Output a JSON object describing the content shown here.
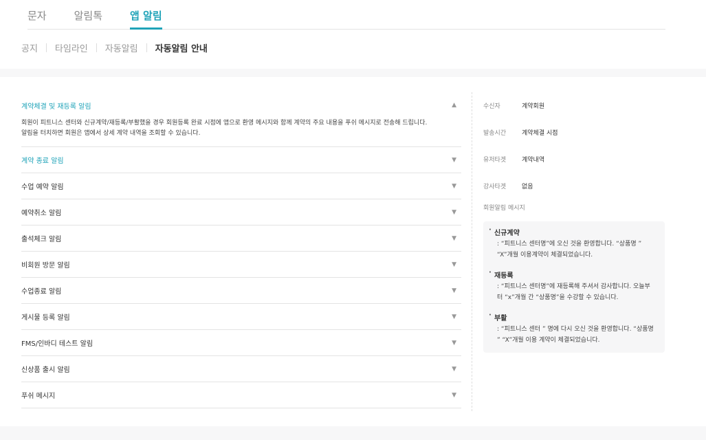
{
  "tabs": [
    {
      "label": "문자",
      "active": false
    },
    {
      "label": "알림톡",
      "active": false
    },
    {
      "label": "앱 알림",
      "active": true
    }
  ],
  "subtabs": [
    {
      "label": "공지",
      "active": false
    },
    {
      "label": "타임라인",
      "active": false
    },
    {
      "label": "자동알림",
      "active": false
    },
    {
      "label": "자동알림 안내",
      "active": true
    }
  ],
  "accordion": {
    "expanded": {
      "label": "계약체결 및 재등록 알림",
      "description_line1": "회원이 피트니스 센터와 신규계약/재등록/부활했을 경우 회원등록 완료 시점에 앱으로 환영 메시지와 함께 계약의 주요 내용을 푸쉬 메시지로 전송해 드립니다.",
      "description_line2": "알림을 터치하면 회원은 앱에서 상세 계약 내역을 조회할 수 있습니다."
    },
    "items": [
      {
        "label": "계약 종료 알림"
      },
      {
        "label": "수업 예약 알림"
      },
      {
        "label": "예약취소 알림"
      },
      {
        "label": "출석체크 알림"
      },
      {
        "label": "비회원 방문 알림"
      },
      {
        "label": "수업종료 알림"
      },
      {
        "label": "게시물 등록 알림"
      },
      {
        "label": "FMS/인바디 테스트 알림"
      },
      {
        "label": "신상품 출시 알림"
      },
      {
        "label": "푸쉬 메시지"
      }
    ]
  },
  "detail": {
    "rows": [
      {
        "key": "수신자",
        "value": "계약회원"
      },
      {
        "key": "발송시간",
        "value": "계약체결 시점"
      },
      {
        "key": "유저타겟",
        "value": "계약내역"
      },
      {
        "key": "강사타겟",
        "value": "없음"
      }
    ],
    "message_title": "회원알림 메시지",
    "messages": [
      {
        "name": "신규계약",
        "line1": ": “피트니스 센터명”에 오신 것을 환영합니다. “상품명 ”",
        "line2": "“X”개월 이용계약이 체결되었습니다."
      },
      {
        "name": "재등록",
        "line1": ": “피트니스 센터명”에 재등록해 주셔서 감사합니다. 오늘부",
        "line2": "터 “x”개월 간 “상품명”을 수강할 수 있습니다."
      },
      {
        "name": "부활",
        "line1": ": “피트니스 센터 ” 명에 다시 오신 것을 환영합니다. “상품명",
        "line2": " ” “X”개월 이용 계약이 체결되었습니다."
      }
    ]
  },
  "icons": {
    "arrow_up": "▲",
    "arrow_down": "▼"
  },
  "colors": {
    "accent": "#1fa3b8"
  }
}
